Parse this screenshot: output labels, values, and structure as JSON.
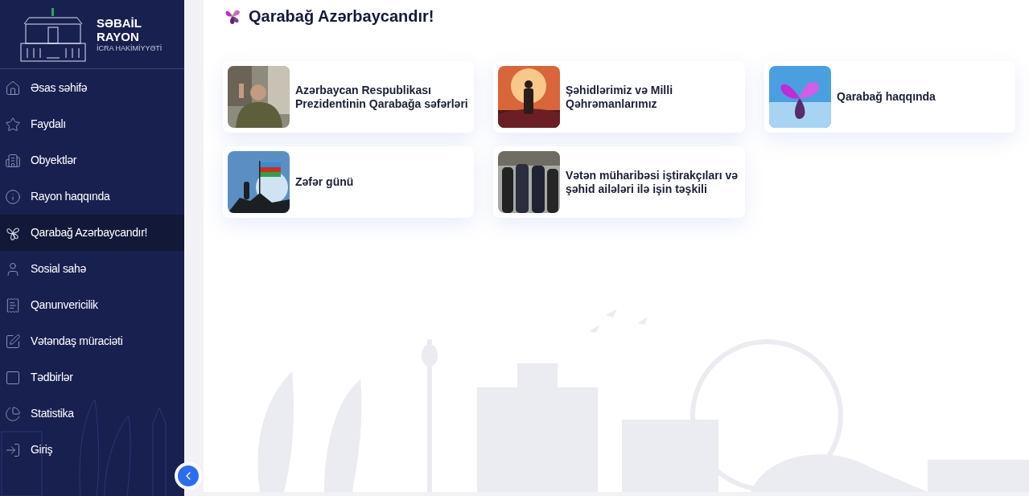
{
  "logo": {
    "line_1": "SƏBAİL",
    "line_2": "RAYON",
    "line_3": "İCRA HAKİMİYYƏTİ"
  },
  "sidebar": {
    "items": [
      {
        "label": "Əsas səhifə",
        "selected": false
      },
      {
        "label": "Faydalı",
        "selected": false
      },
      {
        "label": "Obyektlər",
        "selected": false
      },
      {
        "label": "Rayon haqqında",
        "selected": false
      },
      {
        "label": "Qarabağ Azərbaycandır!",
        "selected": true
      },
      {
        "label": "Sosial sahə",
        "selected": false
      },
      {
        "label": "Qanunvericilik",
        "selected": false
      },
      {
        "label": "Vətəndaş müraciəti",
        "selected": false
      },
      {
        "label": "Tədbirlər",
        "selected": false
      },
      {
        "label": "Statistika",
        "selected": false
      },
      {
        "label": "Giriş",
        "selected": false
      }
    ]
  },
  "page": {
    "title": "Qarabağ Azərbaycandır!"
  },
  "cards": [
    {
      "title": "Azərbaycan Respublikası Prezidentinin Qarabağa səfərləri",
      "kind": "picture"
    },
    {
      "title": "Şəhidlərimiz və Milli Qəhrəmanlarımız",
      "kind": "picture"
    },
    {
      "title": "Qarabağ haqqında",
      "kind": "picture"
    },
    {
      "title": "Zəfər günü",
      "kind": "picture"
    },
    {
      "title": "Vətən müharibəsi iştirakçıları və şəhid ailələri ilə işin təşkili",
      "kind": "picture"
    }
  ]
}
